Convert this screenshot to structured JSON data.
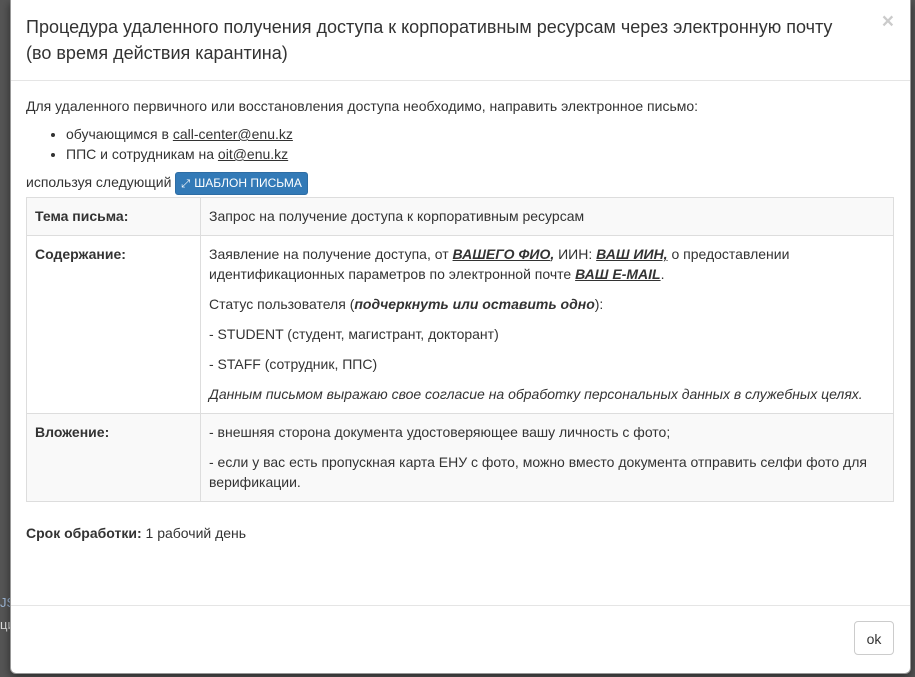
{
  "background": {
    "hint_1": "JS",
    "hint_2": "ци"
  },
  "modal": {
    "title": "Процедура удаленного получения доступа к корпоративным ресурсам через электронную почту (во время действия карантина)",
    "close_glyph": "×",
    "intro": "Для удаленного первичного или восстановления доступа необходимо, направить электронное письмо:",
    "contacts": [
      {
        "prefix": "обучающимся в ",
        "email": "call-center@enu.kz"
      },
      {
        "prefix": "ППС и сотрудникам на ",
        "email": "oit@enu.kz"
      }
    ],
    "using_text": "используя следующий",
    "template_button": {
      "icon": "expand-icon",
      "label": "ШАБЛОН ПИСЬМА",
      "color": "#337ab7"
    },
    "table": {
      "subject_label": "Тема письма:",
      "subject_value": "Запрос на получение доступа к корпоративным ресурсам",
      "content_label": "Содержание:",
      "content": {
        "l1_a": "Заявление на получение доступа, от ",
        "l1_fio": "ВАШЕГО ФИО",
        "l1_comma": ",",
        "l1_b": " ИИН: ",
        "l1_iin": "ВАШ ИИН,",
        "l1_c": " о предоставлении идентификационных параметров по электронной почте ",
        "l1_email": "ВАШ E-MAIL",
        "l1_end": ".",
        "status_a": "Статус пользователя (",
        "status_em": "подчеркнуть или оставить одно",
        "status_b": "):",
        "student": "- STUDENT (студент, магистрант, докторант)",
        "staff": "- STAFF (сотрудник, ППС)",
        "consent": "Данным письмом выражаю свое согласие на обработку персональных данных в служебных целях."
      },
      "attachment_label": "Вложение:",
      "attachment_1": "- внешняя сторона документа удостоверяющее вашу личность с фото;",
      "attachment_2": "- если у вас есть пропускная карта ЕНУ с фото, можно вместо документа отправить селфи фото для верификации."
    },
    "term_label": "Срок обработки:",
    "term_value": " 1 рабочий день",
    "ok_label": "ok"
  }
}
